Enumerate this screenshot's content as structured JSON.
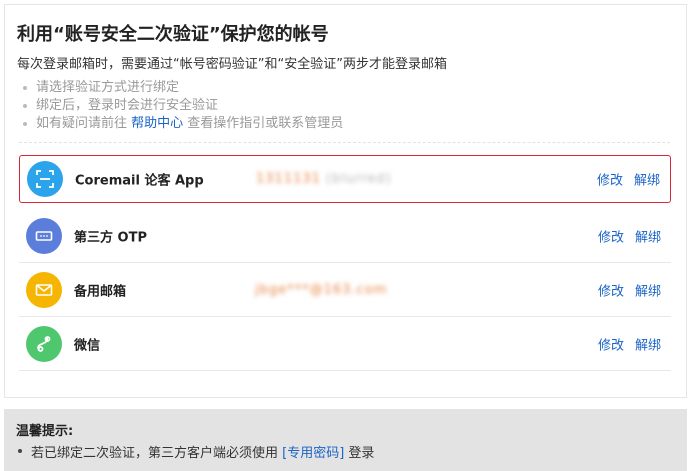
{
  "header": {
    "title": "利用“账号安全二次验证”保护您的帐号",
    "subtitle": "每次登录邮箱时，需要通过“帐号密码验证”和“安全验证”两步才能登录邮箱"
  },
  "tips": {
    "item1": "请选择验证方式进行绑定",
    "item2": "绑定后，登录时会进行安全验证",
    "item3_prefix": "如有疑问请前往 ",
    "item3_link": "帮助中心",
    "item3_suffix": " 查看操作指引或联系管理员"
  },
  "methods": [
    {
      "label": "Coremail 论客 App",
      "masked_primary": "1311131",
      "masked_secondary": "(blurred)",
      "icon": "scan-icon",
      "color": "#2ba4ec",
      "modify": "修改",
      "unbind": "解绑"
    },
    {
      "label": "第三方 OTP",
      "icon": "otp-icon",
      "color": "#5b7ddc",
      "modify": "修改",
      "unbind": "解绑"
    },
    {
      "label": "备用邮箱",
      "masked_primary": "jbge***@163.com",
      "icon": "mail-icon",
      "color": "#f6b500",
      "modify": "修改",
      "unbind": "解绑"
    },
    {
      "label": "微信",
      "icon": "wechat-icon",
      "color": "#4fc76f",
      "modify": "修改",
      "unbind": "解绑"
    }
  ],
  "bottom": {
    "title": "温馨提示:",
    "line_prefix": "若已绑定二次验证，第三方客户端必须使用 ",
    "line_link": "[专用密码]",
    "line_suffix": " 登录"
  }
}
